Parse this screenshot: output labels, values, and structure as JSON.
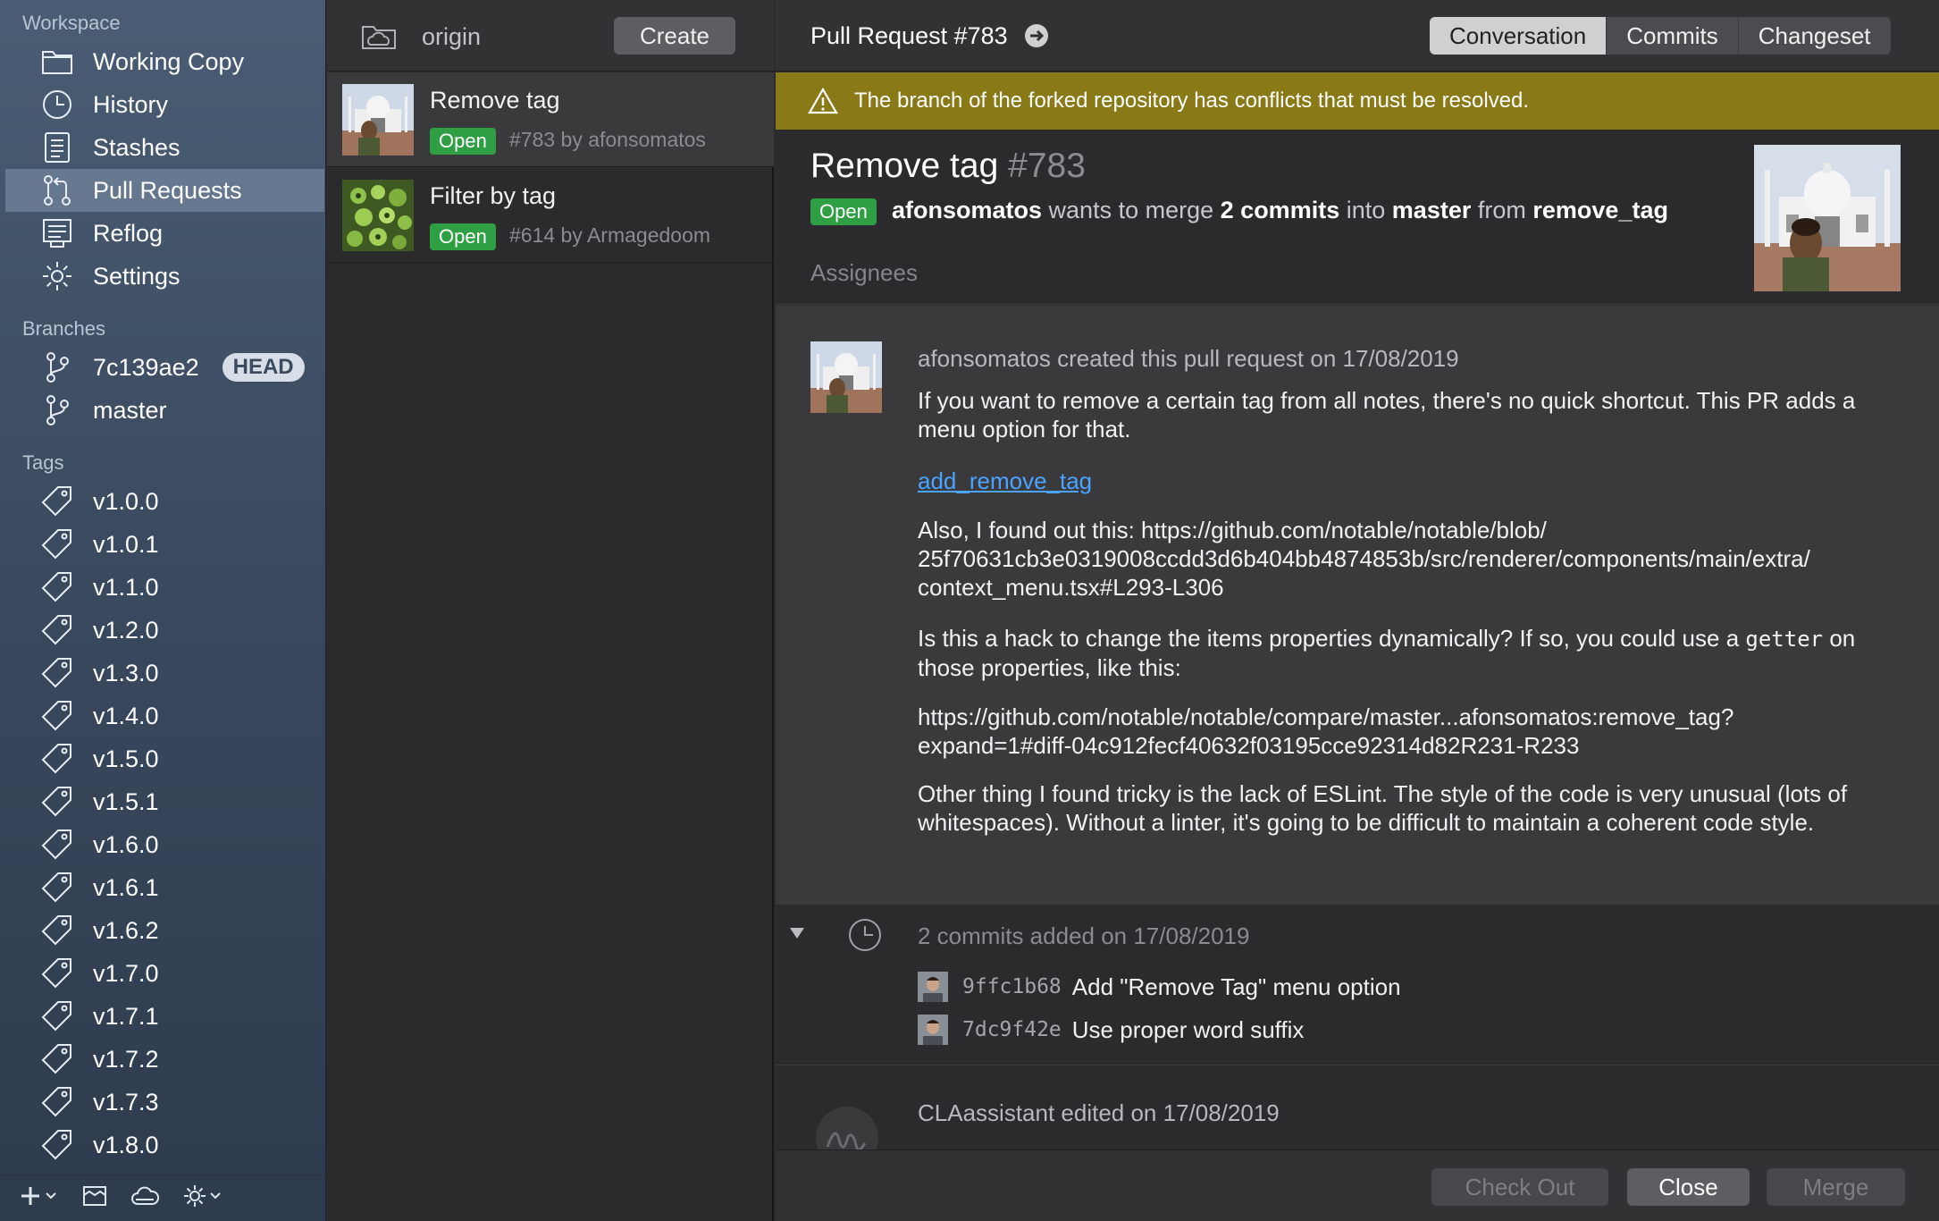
{
  "sidebar": {
    "workspace_header": "Workspace",
    "workspace": [
      {
        "label": "Working Copy",
        "icon": "folder-icon"
      },
      {
        "label": "History",
        "icon": "clock-icon"
      },
      {
        "label": "Stashes",
        "icon": "stash-icon"
      },
      {
        "label": "Pull Requests",
        "icon": "pull-request-icon",
        "selected": true
      },
      {
        "label": "Reflog",
        "icon": "reflog-icon"
      },
      {
        "label": "Settings",
        "icon": "gear-icon"
      }
    ],
    "branches_header": "Branches",
    "branches": [
      {
        "label": "7c139ae2",
        "badge": "HEAD"
      },
      {
        "label": "master",
        "badge": ""
      }
    ],
    "tags_header": "Tags",
    "tags": [
      "v1.0.0",
      "v1.0.1",
      "v1.1.0",
      "v1.2.0",
      "v1.3.0",
      "v1.4.0",
      "v1.5.0",
      "v1.5.1",
      "v1.6.0",
      "v1.6.1",
      "v1.6.2",
      "v1.7.0",
      "v1.7.1",
      "v1.7.2",
      "v1.7.3",
      "v1.8.0"
    ]
  },
  "list": {
    "remote": "origin",
    "create_label": "Create",
    "pull_requests": [
      {
        "title": "Remove tag",
        "state": "Open",
        "meta": "#783 by afonsomatos",
        "selected": true
      },
      {
        "title": "Filter by tag",
        "state": "Open",
        "meta": "#614 by Armagedoom",
        "selected": false
      }
    ]
  },
  "detail": {
    "heading": "Pull Request #783",
    "tabs": [
      {
        "label": "Conversation",
        "active": true
      },
      {
        "label": "Commits",
        "active": false
      },
      {
        "label": "Changeset",
        "active": false
      }
    ],
    "warning": "The branch of the forked repository has conflicts that must be resolved.",
    "title": "Remove tag",
    "number": "#783",
    "state": "Open",
    "author": "afonsomatos",
    "wants_to_merge": "wants to merge",
    "commit_count": "2 commits",
    "into": "into",
    "base": "master",
    "from": "from",
    "head": "remove_tag",
    "assignees_label": "Assignees",
    "comment": {
      "header": "afonsomatos created this pull request on 17/08/2019",
      "p1": "If you want to remove a certain tag from all notes, there's no quick shortcut. This PR adds a menu option for that.",
      "link": "add_remove_tag",
      "p2_line1": "Also, I found out this: https://github.com/notable/notable/blob/",
      "p2_line2": "25f70631cb3e0319008ccdd3d6b404bb4874853b/src/renderer/components/main/extra/",
      "p2_line3": "context_menu.tsx#L293-L306",
      "p3_before": "Is this a hack to change the items properties dynamically? If so, you could use a",
      "p3_code": "getter",
      "p3_after": "on those properties, like this:",
      "p4_line1": "https://github.com/notable/notable/compare/master...afonsomatos:remove_tag?",
      "p4_line2": "expand=1#diff-04c912fecf40632f03195cce92314d82R231-R233",
      "p5": "Other thing I found tricky is the lack of ESLint. The style of the code is very unusual (lots of whitespaces). Without a linter, it's going to be difficult to maintain a coherent code style."
    },
    "commits_header": "2 commits added on 17/08/2019",
    "commits": [
      {
        "sha": "9ffc1b68",
        "message": "Add \"Remove Tag\" menu option"
      },
      {
        "sha": "7dc9f42e",
        "message": "Use proper word suffix"
      }
    ],
    "cla_event": "CLAassistant edited on 17/08/2019",
    "footer": {
      "checkout": "Check Out",
      "close": "Close",
      "merge": "Merge"
    }
  },
  "colors": {
    "open_badge": "#2ea043",
    "warning_bar": "#8a7a17",
    "link": "#4aa3ff",
    "sidebar_selected": "#6b7f97"
  }
}
